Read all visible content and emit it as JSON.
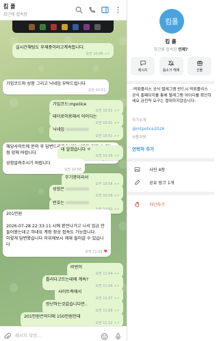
{
  "chat": {
    "title": "킴 폴",
    "status": "최근에 접속함",
    "input_placeholder": "메시지 작성...",
    "messages": [
      {
        "text": "실시간채팅도 부재중이라고계속뜹니다.",
        "time": "오전 10:49",
        "dir": "out",
        "read": true
      },
      {
        "text": "가입코드와 성함 그리고 닉네임 부탁드립니다",
        "time": "오전 10:51",
        "dir": "in"
      },
      {
        "text": "가입코드:mpolice",
        "time": "오전 10:51",
        "dir": "out",
        "read": true
      },
      {
        "text": "테더로이용해서 아이디는",
        "time": "오전 10:51",
        "dir": "out",
        "read": true
      },
      {
        "text": "닉네임",
        "time": "오전 10:51",
        "dir": "out",
        "read": true
      },
      {
        "text": "해당사이트에 문의 후 답변드리겠습니다 시간이 걸릴 수 있는점 양해 바랍니다",
        "time": "오전 10:52",
        "dir": "in"
      },
      {
        "text": "네 알겠습니다 ㅠ",
        "time": "오전 10:58",
        "dir": "out",
        "read": true
      },
      {
        "text": "성함알려주시기 바랍니다",
        "time": "오전 10:58",
        "dir": "in"
      },
      {
        "text": "무기명이라서",
        "time": "오전 10:58",
        "dir": "out",
        "read": true
      },
      {
        "text": "성함은",
        "time": "오전 10:58",
        "dir": "out",
        "read": true
      },
      {
        "text": "번호는",
        "time": "오전 10:59",
        "dir": "out",
        "read": true
      },
      {
        "text": "201만원\n\n2026-07-28 22:33:11 시에 환전나가고 나서 입금 안들어왔는데고 하네요 계정 정상 접속도 가능합니다.\n이렇게 답변왔습니다 허위재보시 제재 들어갈 수 있습니다",
        "time": "오전 11:01",
        "dir": "in"
      },
      {
        "text": "비번이",
        "time": "오전 11:04",
        "dir": "out",
        "read": true
      },
      {
        "text": "틀리다고뜨는데에 계속?",
        "time": "오전 11:04",
        "dir": "out",
        "read": true
      },
      {
        "text": "사이트측에서",
        "time": "오전 11:07",
        "dir": "out",
        "read": true
      },
      {
        "text": "장난하는것같습니다만..",
        "time": "오전 11:08",
        "dir": "out",
        "read": true
      },
      {
        "text": "201만원은어디에 150만원인데",
        "time": "오전 11:12",
        "dir": "out",
        "read": true
      }
    ]
  },
  "profile": {
    "avatar_text": "킴폴",
    "avatar_color": "#4aa3df",
    "name": "킴 폴",
    "status": "최근에 접속함",
    "status_when": "언제?",
    "actions": [
      {
        "label": "메시지",
        "icon": "message-icon"
      },
      {
        "label": "음소거 해제",
        "icon": "mute-icon"
      },
      {
        "label": "선물",
        "icon": "gift-icon"
      }
    ],
    "bio": "-먹튀폴리스 공식 텔레그램 반드시 먹튀폴리스 공식 홈페이지를 통해 텔레그램 아이디를 확인하세요 금전적 요구는 절대하지않습니다-",
    "bio_label": "자기소개",
    "username": "@mtpolice2026",
    "username_label": "사용자명",
    "add_contact": "연락처 추가",
    "photos": "사진 4장",
    "links": "공유 링크 1개",
    "block": "차단하기"
  },
  "colors": {
    "accent": "#3a8fd9",
    "danger": "#e05555",
    "read_check": "#4fae4e"
  }
}
